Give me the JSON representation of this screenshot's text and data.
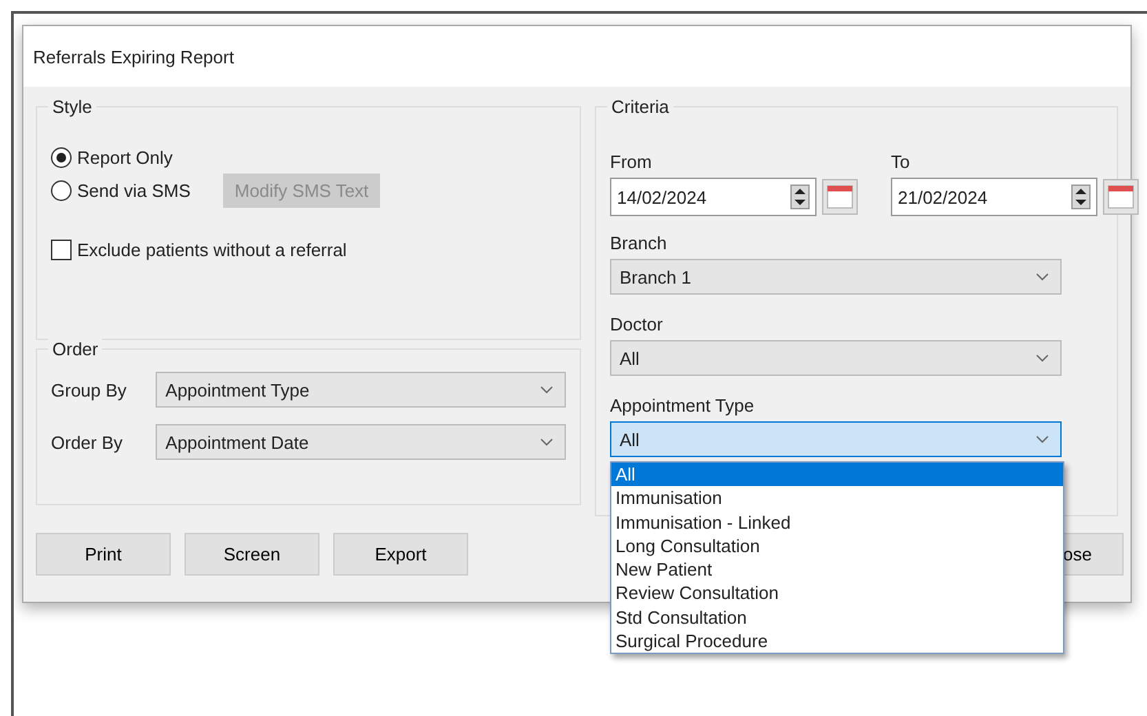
{
  "window": {
    "title": "Referrals Expiring Report"
  },
  "style": {
    "title": "Style",
    "options": [
      {
        "label": "Report Only",
        "selected": true
      },
      {
        "label": "Send via SMS",
        "selected": false
      }
    ],
    "sms_button": {
      "label": "Modify SMS Text",
      "disabled": true
    },
    "exclude": {
      "label": "Exclude patients without a referral",
      "checked": false
    }
  },
  "order": {
    "title": "Order",
    "fields": [
      {
        "label": "Group By",
        "value": "Appointment Type"
      },
      {
        "label": "Order By",
        "value": "Appointment Date"
      }
    ]
  },
  "criteria": {
    "title": "Criteria",
    "dates": [
      {
        "label": "From",
        "value": "14/02/2024"
      },
      {
        "label": "To",
        "value": "21/02/2024"
      }
    ],
    "combos": [
      {
        "label": "Branch",
        "value": "Branch 1",
        "focused": false
      },
      {
        "label": "Doctor",
        "value": "All",
        "focused": false
      },
      {
        "label": "Appointment Type",
        "value": "All",
        "focused": true
      }
    ],
    "dropdown": [
      {
        "label": "All",
        "selected": true
      },
      {
        "label": "Immunisation",
        "selected": false
      },
      {
        "label": "Immunisation - Linked",
        "selected": false
      },
      {
        "label": "Long Consultation",
        "selected": false
      },
      {
        "label": "New Patient",
        "selected": false
      },
      {
        "label": "Review Consultation",
        "selected": false
      },
      {
        "label": "Std Consultation",
        "selected": false
      },
      {
        "label": "Surgical Procedure",
        "selected": false
      }
    ]
  },
  "buttons": [
    {
      "label": "Print"
    },
    {
      "label": "Screen"
    },
    {
      "label": "Export"
    }
  ],
  "close_button": {
    "label": "ose"
  }
}
